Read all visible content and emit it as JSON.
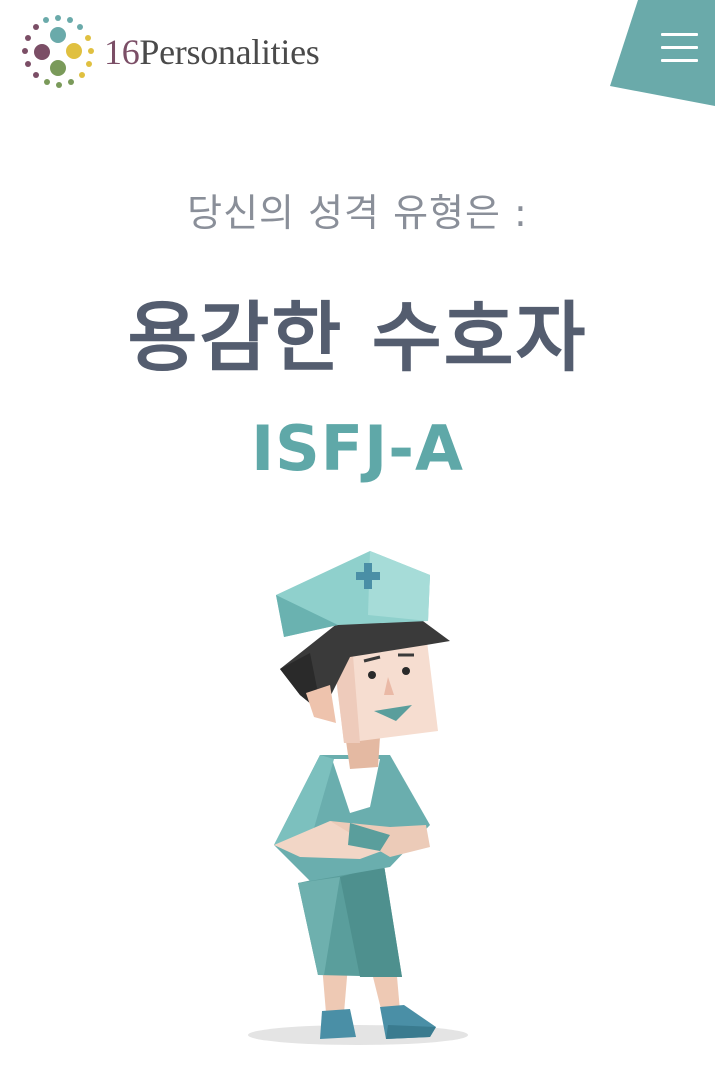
{
  "header": {
    "logo_number": "16",
    "logo_word": "Personalities",
    "menu_icon": "hamburger-menu-icon"
  },
  "result": {
    "subtitle": "당신의 성격 유형은 :",
    "type_name": "용감한 수호자",
    "type_code": "ISFJ-A"
  },
  "illustration": {
    "subject": "nurse-character"
  },
  "colors": {
    "teal": "#5fa8a8",
    "menu_tab": "#6aaaaa",
    "title": "#545d6f",
    "subtitle": "#8a8f99",
    "logo_number": "#7b4e66"
  }
}
